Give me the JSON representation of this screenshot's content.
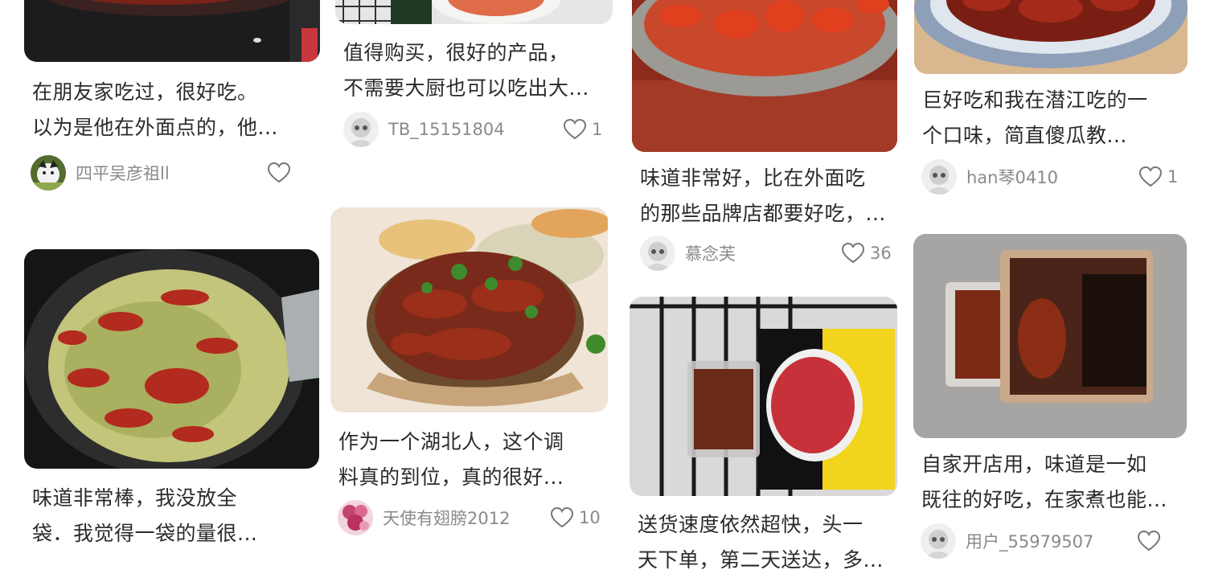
{
  "posts": [
    {
      "line1": "在朋友家吃过，很好吃。",
      "line2": "以为是他在外面点的，他...",
      "user": "四平吴彦祖ll",
      "likes": ""
    },
    {
      "line1": "值得购买，很好的产品，",
      "line2": "不需要大厨也可以吃出大...",
      "user": "TB_15151804",
      "likes": "1"
    },
    {
      "line1": "味道非常好，比在外面吃",
      "line2": "的那些品牌店都要好吃，...",
      "user": "慕念芙",
      "likes": "36"
    },
    {
      "line1": "巨好吃和我在潜江吃的一",
      "line2": "个口味，简直傻瓜教...",
      "user": "han琴0410",
      "likes": "1"
    },
    {
      "line1": "味道非常棒，我没放全",
      "line2": "袋．我觉得一袋的量很...",
      "user": "",
      "likes": ""
    },
    {
      "line1": "作为一个湖北人，这个调",
      "line2": "料真的到位，真的很好...",
      "user": "天使有翅膀2012",
      "likes": "10"
    },
    {
      "line1": "送货速度依然超快，头一",
      "line2": "天下单，第二天送达，多...",
      "user": "",
      "likes": ""
    },
    {
      "line1": "自家开店用，味道是一如",
      "line2": "既往的好吃，在家煮也能...",
      "user": "用户_55979507",
      "likes": ""
    }
  ],
  "colors": {
    "heart": "#777777",
    "muted": "#8a8a8a",
    "text": "#2b2b2b"
  }
}
